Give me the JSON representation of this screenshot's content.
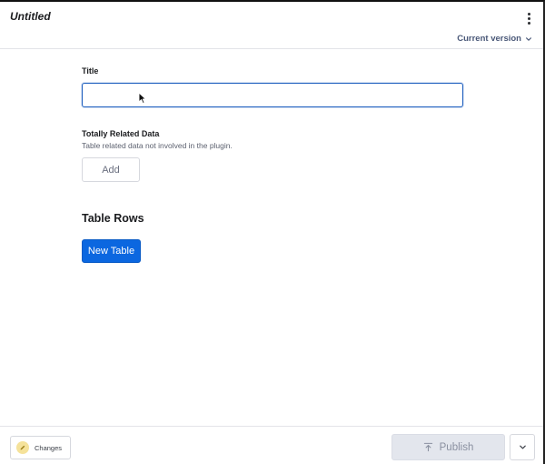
{
  "header": {
    "document_title": "Untitled",
    "menu_icon": "more-vertical-icon",
    "version_label": "Current version",
    "version_icon": "chevron-down-icon"
  },
  "form": {
    "title_label": "Title",
    "title_value": "",
    "related_label": "Totally Related Data",
    "related_description": "Table related data not involved in the plugin.",
    "add_label": "Add",
    "rows_heading": "Table Rows",
    "new_table_label": "New Table"
  },
  "footer": {
    "changes_label": "Changes",
    "changes_icon": "pencil-icon",
    "publish_label": "Publish",
    "publish_icon": "upload-arrow-icon",
    "publish_more_icon": "chevron-down-icon"
  },
  "colors": {
    "primary": "#0b67e0",
    "focus_border": "#1e5fbf",
    "disabled_bg": "#e3e6ed",
    "changes_badge": "#f5e29a"
  }
}
